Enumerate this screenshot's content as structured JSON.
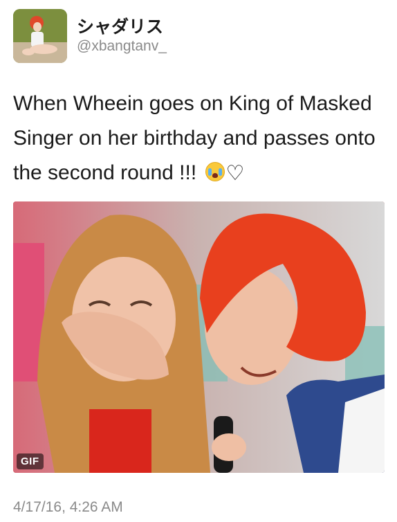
{
  "tweet": {
    "display_name": "シャダリス",
    "handle": "@xbangtanv_",
    "text": "When Wheein goes on King of Masked Singer on her birthday and passes onto the second round !!!",
    "emoji_icons": [
      "loudly-crying-face-icon",
      "white-heart-icon"
    ],
    "media_badge": "GIF",
    "timestamp": "4/17/16, 4:26 AM"
  }
}
